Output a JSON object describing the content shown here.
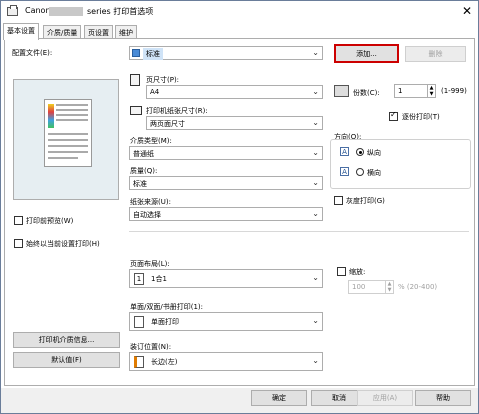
{
  "window": {
    "title_prefix": "Canon",
    "title_suffix": "series 打印首选项",
    "close_glyph": "✕"
  },
  "tabs": [
    {
      "label": "基本设置",
      "active": true
    },
    {
      "label": "介质/质量",
      "active": false
    },
    {
      "label": "页设置",
      "active": false
    },
    {
      "label": "维护",
      "active": false
    }
  ],
  "profile": {
    "label": "配置文件(E):",
    "value": "标准",
    "add_label": "添加...",
    "delete_label": "删除"
  },
  "page_size": {
    "label": "页尺寸(P):",
    "value": "A4"
  },
  "output_size": {
    "label": "打印机纸张尺寸(R):",
    "value": "两页面尺寸"
  },
  "media_type": {
    "label": "介质类型(M):",
    "value": "普通纸"
  },
  "quality": {
    "label": "质量(Q):",
    "value": "标准"
  },
  "paper_source": {
    "label": "纸张来源(U):",
    "value": "自动选择"
  },
  "preview_before_print": {
    "label": "打印前预览(W)",
    "checked": false
  },
  "always_print_current": {
    "label": "始终以当前设置打印(H)",
    "checked": false
  },
  "copies": {
    "label": "份数(C):",
    "value": "1",
    "range": "(1-999)"
  },
  "collate": {
    "label": "逐份打印(T)",
    "checked": true
  },
  "orientation": {
    "label": "方向(O):",
    "portrait": "纵向",
    "landscape": "横向",
    "selected": "portrait"
  },
  "grayscale": {
    "label": "灰度打印(G)",
    "checked": false
  },
  "page_layout": {
    "label": "页面布局(L):",
    "value": "1合1"
  },
  "scaling": {
    "label": "缩放:",
    "value": "100",
    "unit": "% (20-400)",
    "checked": false
  },
  "duplex": {
    "label": "单面/双面/书册打印(1):",
    "value": "单面打印"
  },
  "stapling": {
    "label": "装订位置(N):",
    "value": "长边(左)"
  },
  "left_buttons": {
    "media_info": "打印机介质信息...",
    "defaults": "默认值(F)"
  },
  "bottom_buttons": {
    "ok": "确定",
    "cancel": "取消",
    "apply": "应用(A)",
    "help": "帮助"
  },
  "accent": {
    "highlight_border": "#cc0000",
    "combo_selected_bg": "#cfe3f7"
  }
}
